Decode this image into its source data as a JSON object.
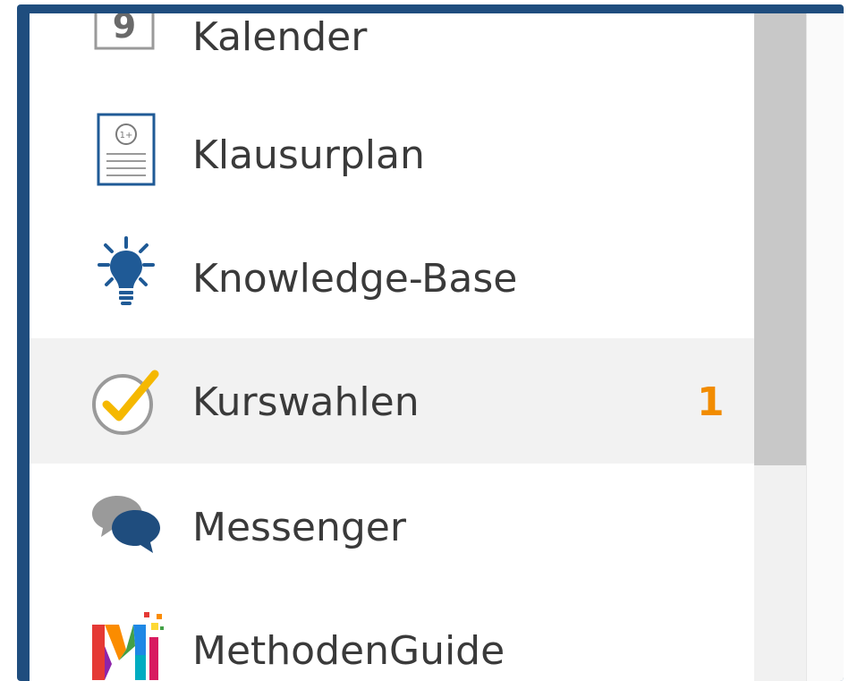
{
  "menu": {
    "items": [
      {
        "label": "Kalender",
        "icon": "calendar-icon",
        "icon_number": "9"
      },
      {
        "label": "Klausurplan",
        "icon": "exam-plan-icon",
        "icon_text": "1+"
      },
      {
        "label": "Knowledge-Base",
        "icon": "lightbulb-icon"
      },
      {
        "label": "Kurswahlen",
        "icon": "checkmark-circle-icon",
        "badge": "1",
        "active": true
      },
      {
        "label": "Messenger",
        "icon": "chat-bubbles-icon"
      },
      {
        "label": "MethodenGuide",
        "icon": "methodenguide-logo-icon"
      }
    ]
  },
  "colors": {
    "frame": "#1f4d7e",
    "badge": "#f28c00",
    "active_bg": "#f2f2f2",
    "icon_blue": "#1f5a96",
    "check_yellow": "#f5b800"
  }
}
